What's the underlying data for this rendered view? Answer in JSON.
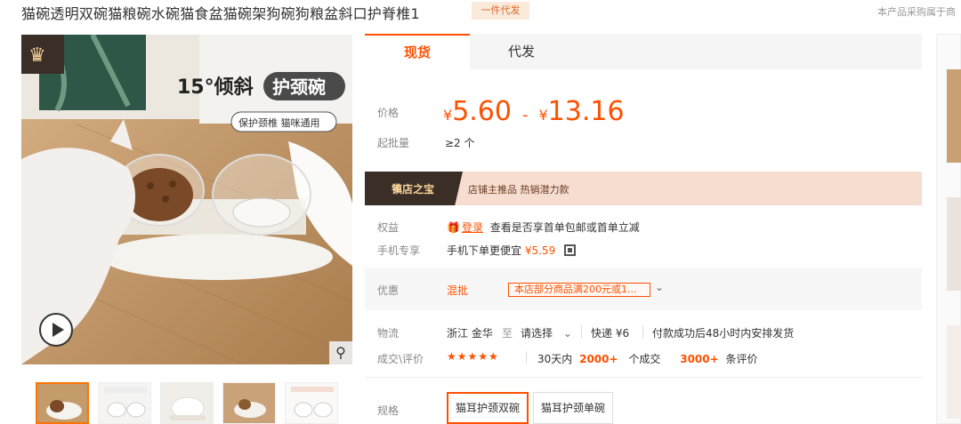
{
  "product": {
    "title": "猫碗透明双碗猫粮碗水碗猫食盆猫碗架狗碗狗粮盆斜口护脊椎1",
    "badge": "一件代发",
    "note": "本产品采购属于商"
  },
  "gallery": {
    "main_headline": "15°倾斜",
    "main_headline_tag": "护颈碗",
    "main_subtag": "保护颈椎 猫咪通用",
    "video_icon": "play-icon",
    "zoom_icon": "search-icon",
    "thumbnails": [
      "thumb-1",
      "thumb-2",
      "thumb-3",
      "thumb-4",
      "thumb-5"
    ],
    "brand_icon": "crown-icon"
  },
  "tabs": {
    "spot": "现货",
    "dropship": "代发"
  },
  "price": {
    "label": "价格",
    "currency": "¥",
    "min": "5.60",
    "dash": "-",
    "max": "13.16"
  },
  "moq": {
    "label": "起批量",
    "value": "≥2 个"
  },
  "banner": {
    "title": "镇店之宝",
    "tags": "店铺主推品  热销潜力款"
  },
  "benefits": {
    "label": "权益",
    "login": "登录",
    "text": "查看是否享首单包邮或首单立减"
  },
  "mobile": {
    "label": "手机专享",
    "text": "手机下单更便宜",
    "price": "¥5.59"
  },
  "discount": {
    "label": "优惠",
    "type": "混批",
    "promo": "本店部分商品满200元或1..."
  },
  "logistics": {
    "label": "物流",
    "origin": "浙江 金华",
    "to": "至",
    "destination": "请选择",
    "express": "快递 ¥6",
    "delivery": "付款成功后48小时内安排发货"
  },
  "deals": {
    "label": "成交\\评价",
    "stars": "★★★★★",
    "prefix": "30天内",
    "sold": "2000+",
    "sold_unit": "个成交",
    "reviews": "3000+",
    "reviews_unit": "条评价"
  },
  "specs": {
    "label": "规格",
    "options": [
      "猫耳护颈双碗",
      "猫耳护颈单碗"
    ]
  },
  "colors": {
    "accent": "#ff5000",
    "banner_bg": "#f6ddd0",
    "banner_dark": "#3a2e27"
  }
}
